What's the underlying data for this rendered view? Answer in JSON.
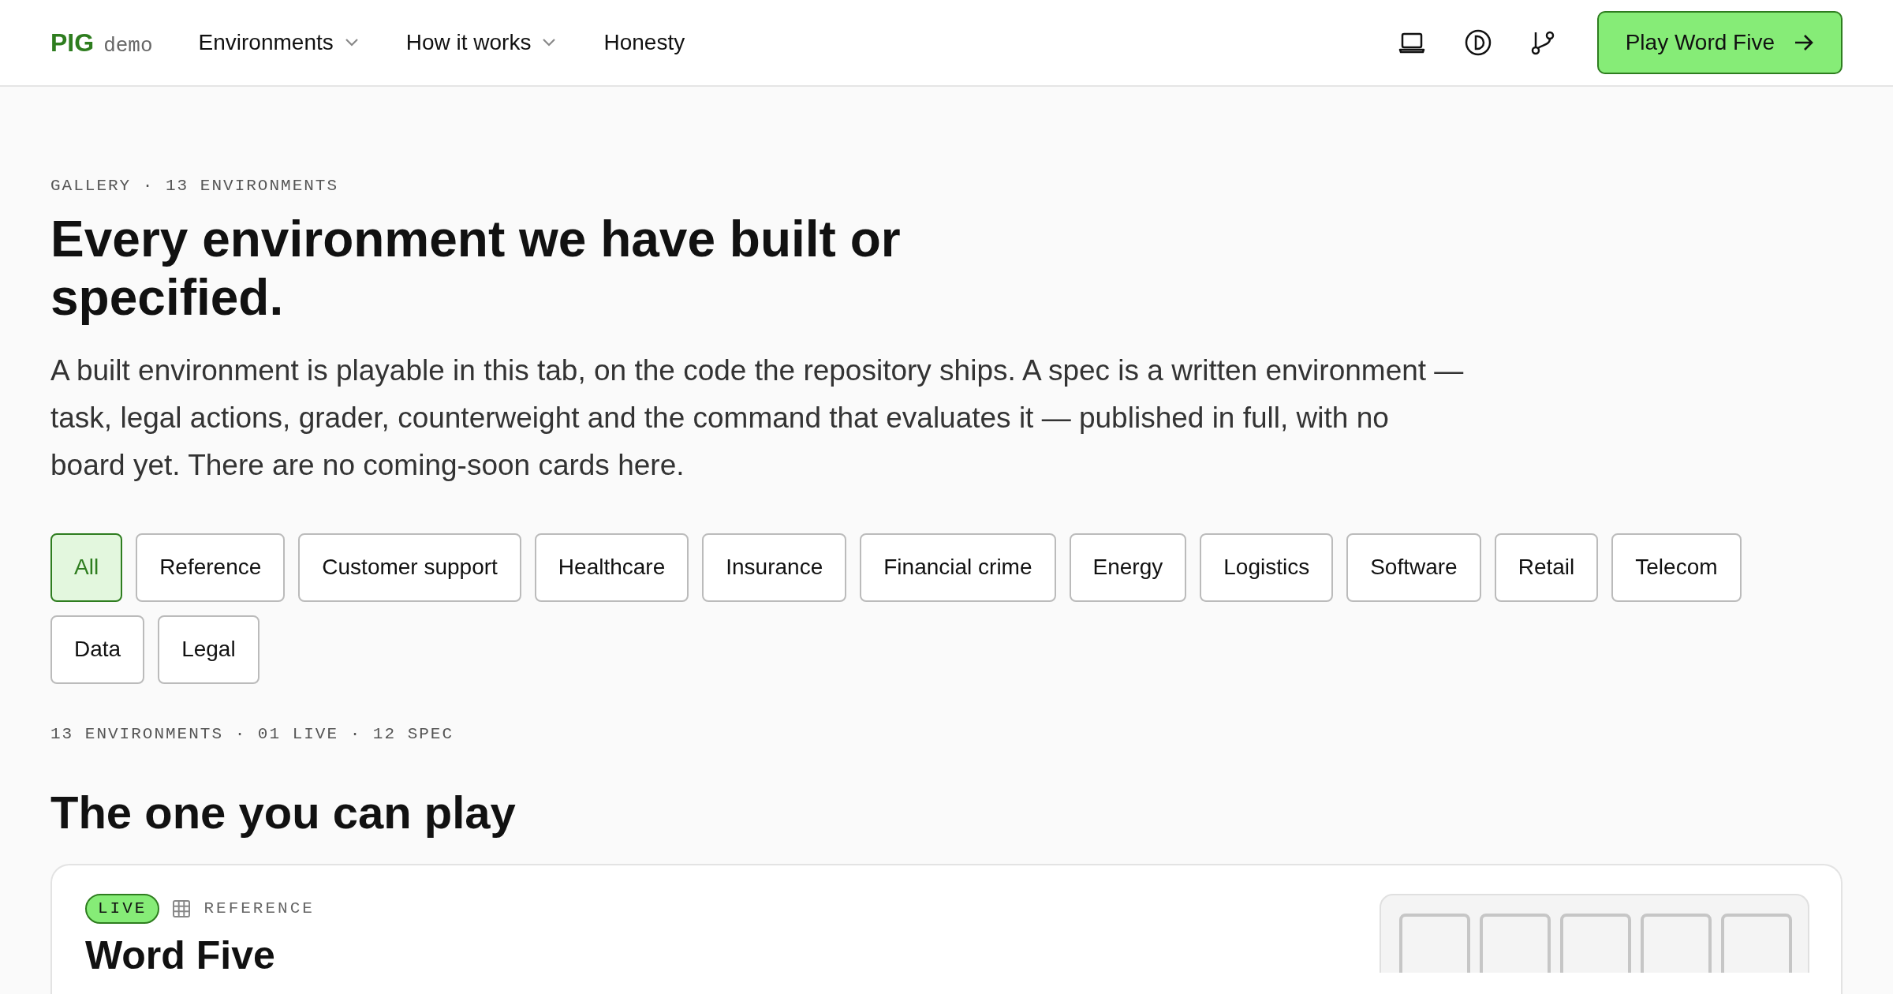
{
  "header": {
    "logo": "PIG",
    "logo_suffix": "demo",
    "nav": [
      {
        "label": "Environments",
        "dropdown": true
      },
      {
        "label": "How it works",
        "dropdown": true
      },
      {
        "label": "Honesty",
        "dropdown": false
      }
    ],
    "cta": "Play Word Five"
  },
  "eyebrow": "GALLERY · 13 ENVIRONMENTS",
  "title": "Every environment we have built or specified.",
  "intro": "A built environment is playable in this tab, on the code the repository ships. A spec is a written environment — task, legal actions, grader, counterweight and the command that evaluates it — published in full, with no board yet. There are no coming-soon cards here.",
  "filters": [
    {
      "label": "All",
      "selected": true
    },
    {
      "label": "Reference",
      "selected": false
    },
    {
      "label": "Customer support",
      "selected": false
    },
    {
      "label": "Healthcare",
      "selected": false
    },
    {
      "label": "Insurance",
      "selected": false
    },
    {
      "label": "Financial crime",
      "selected": false
    },
    {
      "label": "Energy",
      "selected": false
    },
    {
      "label": "Logistics",
      "selected": false
    },
    {
      "label": "Software",
      "selected": false
    },
    {
      "label": "Retail",
      "selected": false
    },
    {
      "label": "Telecom",
      "selected": false
    },
    {
      "label": "Data",
      "selected": false
    },
    {
      "label": "Legal",
      "selected": false
    }
  ],
  "counts": "13 ENVIRONMENTS · 01 LIVE · 12 SPEC",
  "section_title": "The one you can play",
  "card": {
    "status": "LIVE",
    "category": "REFERENCE",
    "title": "Word Five"
  }
}
